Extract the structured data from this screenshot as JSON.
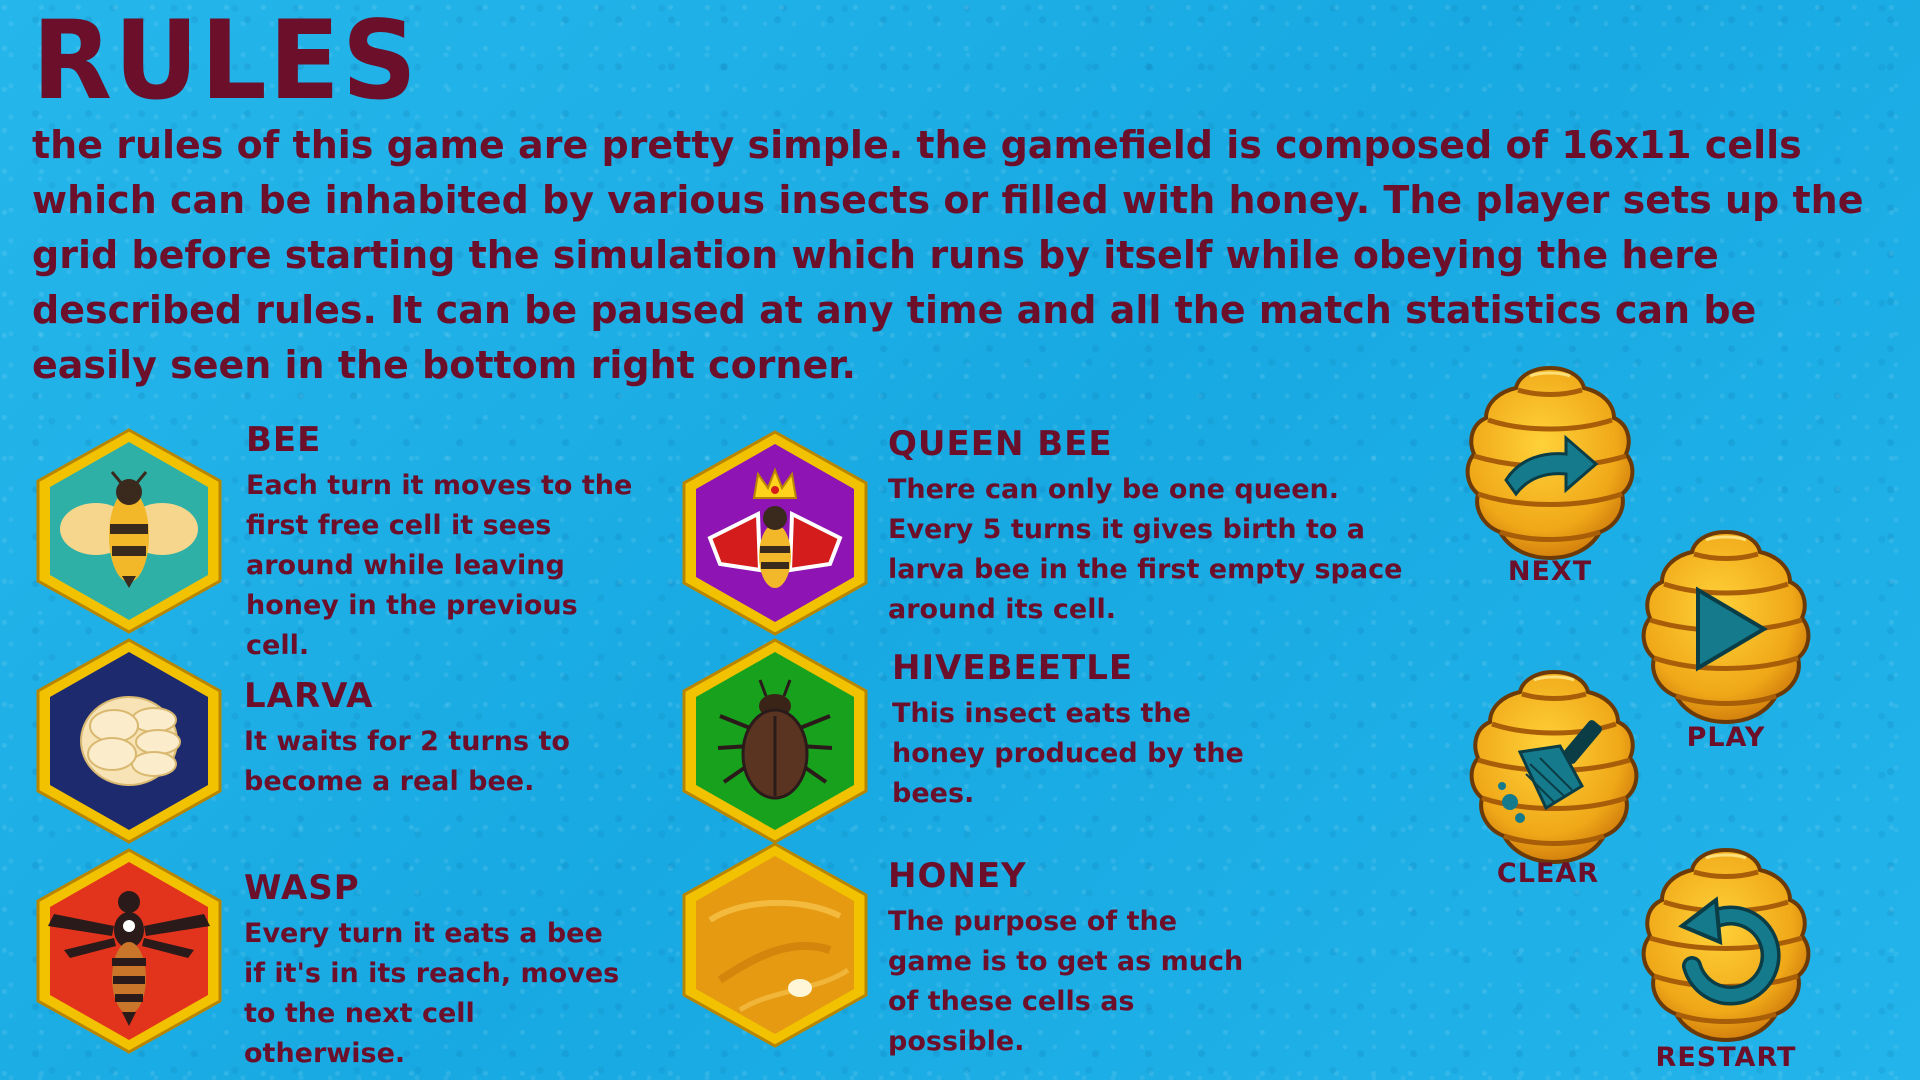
{
  "page": {
    "title": "RULES",
    "intro": "the rules of this game are pretty simple. the gamefield is composed of 16x11 cells which can be inhabited by various insects or filled with honey. The player sets up the grid before starting the simulation which runs by itself while obeying the here described rules. It can be paused at any time and all the match statistics can be easily seen in the bottom right corner."
  },
  "entries": {
    "bee": {
      "name": "BEE",
      "desc": "Each turn it moves to the first free cell it sees around while leaving honey in the previous cell.",
      "icon": "bee-icon",
      "bg": "#2fb0a6"
    },
    "larva": {
      "name": "LARVA",
      "desc": "It waits for 2 turns to become a real bee.",
      "icon": "larva-icon",
      "bg": "#1e2a6e"
    },
    "wasp": {
      "name": "WASP",
      "desc": "Every turn it eats a bee if it's in its reach, moves to the next cell otherwise.",
      "icon": "wasp-icon",
      "bg": "#e2331c"
    },
    "queen": {
      "name": "QUEEN BEE",
      "desc": "There can only be one queen. Every 5 turns it gives birth to a larva bee in the first empty space around its cell.",
      "icon": "queen-bee-icon",
      "bg": "#8e14b3"
    },
    "beetle": {
      "name": "HIVEBEETLE",
      "desc": "This insect eats the honey produced by the bees.",
      "icon": "hive-beetle-icon",
      "bg": "#18a11d"
    },
    "honey": {
      "name": "HONEY",
      "desc": "The purpose of the game is to get as much of these cells as possible.",
      "icon": "honey-icon",
      "bg": "#e59a12"
    }
  },
  "buttons": {
    "next": {
      "label": "NEXT",
      "icon": "arrow-right-icon"
    },
    "play": {
      "label": "PLAY",
      "icon": "play-icon"
    },
    "clear": {
      "label": "CLEAR",
      "icon": "brush-icon"
    },
    "restart": {
      "label": "RESTART",
      "icon": "restart-icon"
    }
  },
  "colors": {
    "text": "#6b0f2a",
    "background": "#1fb2e6",
    "hex_border": "#f2c200",
    "hive": "#f0a818",
    "button_icon": "#157a8c"
  }
}
